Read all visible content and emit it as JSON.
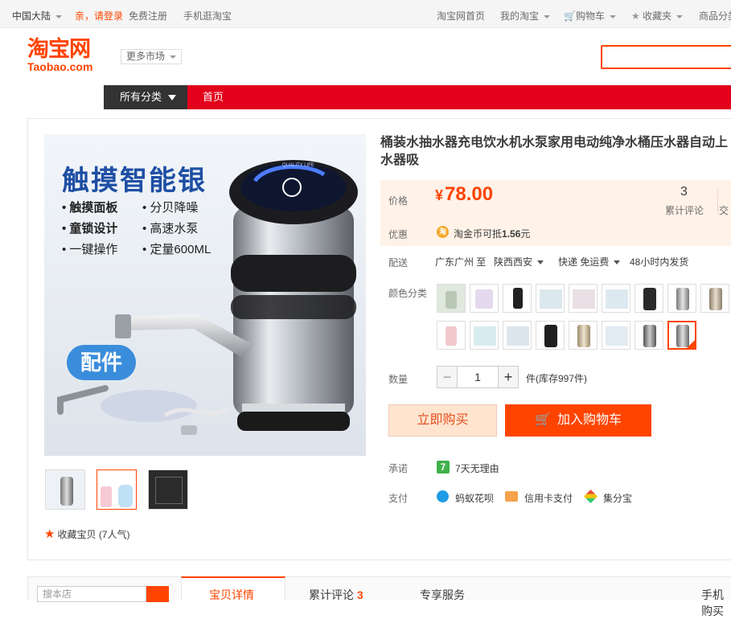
{
  "sitebar": {
    "region": "中国大陆",
    "login": "亲，请登录",
    "register": "免费注册",
    "mobile": "手机逛淘宝",
    "home": "淘宝网首页",
    "my_taobao": "我的淘宝",
    "cart": "购物车",
    "favorites": "收藏夹",
    "category": "商品分类"
  },
  "header": {
    "logo_cn": "淘宝网",
    "logo_en": "Taobao.com",
    "more_market": "更多市场"
  },
  "nav": {
    "all_categories": "所有分类",
    "home": "首页"
  },
  "product": {
    "title": "桶装水抽水器充电饮水机水泵家用电动纯净水桶压水器自动上水器吸",
    "price_label": "价格",
    "currency": "¥",
    "price": "78.00",
    "review_count": "3",
    "review_label": "累计评论",
    "trade_label": "交易",
    "promo_label": "优惠",
    "coin_icon": "淘",
    "promo_prefix": "淘金币可抵",
    "promo_amount": "1.56",
    "promo_suffix": "元",
    "ship_label": "配送",
    "ship_from": "广东广州 至",
    "ship_to": "陕西西安",
    "ship_method": "快递 免运费",
    "ship_time": "48小时内发货",
    "color_label": "颜色分类",
    "qty_label": "数量",
    "qty_value": "1",
    "qty_minus": "−",
    "qty_plus": "+",
    "stock": "件(库存997件)",
    "buy_now": "立即购买",
    "add_cart": "加入购物车",
    "promise_label": "承诺",
    "promise_icon": "7",
    "promise_text": "7天无理由",
    "pay_label": "支付",
    "pay_options": [
      "蚂蚁花呗",
      "信用卡支付",
      "集分宝"
    ],
    "collect": "收藏宝贝",
    "collect_count": "(7人气)"
  },
  "main_image": {
    "headline": "触摸智能银",
    "features": [
      "触摸面板",
      "分贝降噪",
      "童锁设计",
      "高速水泵",
      "一键操作",
      "定量600ML"
    ],
    "badge": "配件",
    "device_brand": "QUALITY LIFE"
  },
  "bottom": {
    "shop_search_placeholder": "搜本店",
    "tabs": [
      "宝贝详情",
      "累计评论",
      "专享服务",
      "手机购买"
    ],
    "review_count": "3"
  },
  "colors": {
    "accent": "#ff4400",
    "nav_red": "#e2001a",
    "price_bg": "#fff2e8"
  }
}
